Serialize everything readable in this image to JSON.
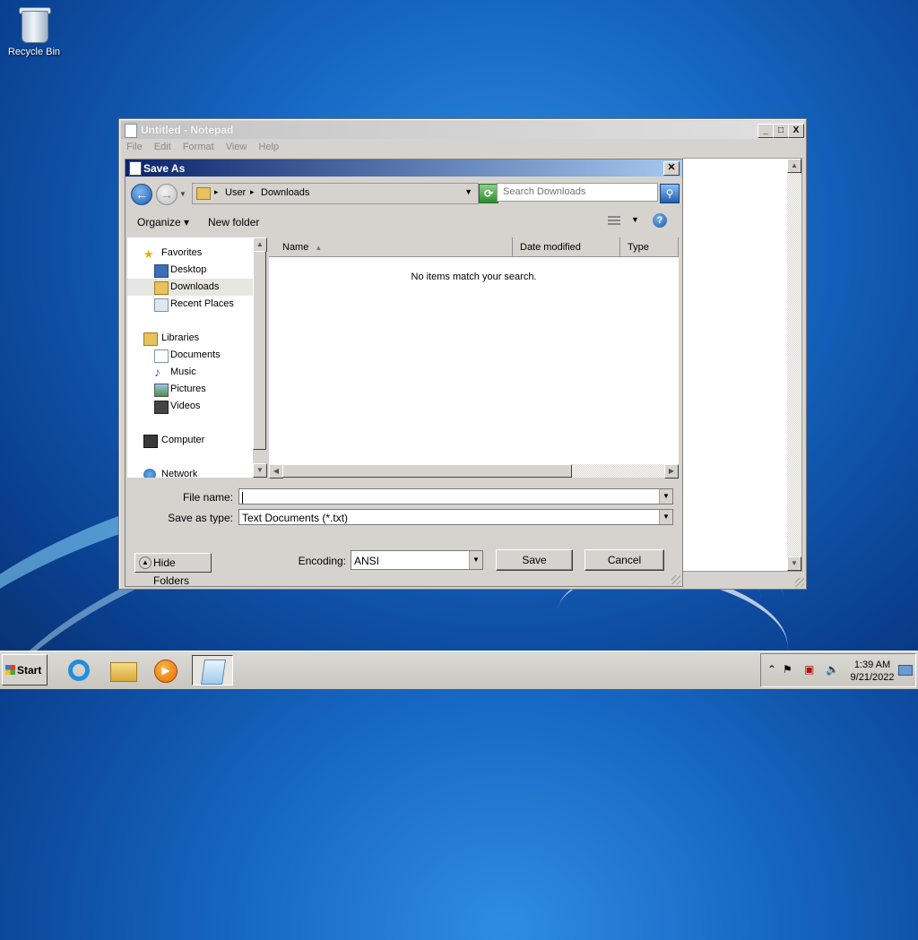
{
  "desktop": {
    "recycle_bin_label": "Recycle Bin"
  },
  "notepad": {
    "title": "Untitled - Notepad",
    "menu": [
      "File",
      "Edit",
      "Format",
      "View",
      "Help"
    ],
    "window_buttons": {
      "minimize": "_",
      "maximize": "□",
      "close": "X"
    }
  },
  "dialog": {
    "title": "Save As",
    "close_glyph": "✕",
    "address": {
      "crumb1": "User",
      "crumb2": "Downloads"
    },
    "search": {
      "placeholder": "Search Downloads"
    },
    "toolbar": {
      "organize": "Organize ▾",
      "new_folder": "New folder",
      "help": "?"
    },
    "nav": {
      "favorites": "Favorites",
      "desktop": "Desktop",
      "downloads": "Downloads",
      "recent_places": "Recent Places",
      "libraries": "Libraries",
      "documents": "Documents",
      "music": "Music",
      "pictures": "Pictures",
      "videos": "Videos",
      "computer": "Computer",
      "network": "Network"
    },
    "columns": {
      "name": "Name",
      "date_modified": "Date modified",
      "type": "Type"
    },
    "empty_message": "No items match your search.",
    "file_name_label": "File name:",
    "file_name_value": "",
    "save_as_type_label": "Save as type:",
    "save_as_type_value": "Text Documents (*.txt)",
    "encoding_label": "Encoding:",
    "encoding_value": "ANSI",
    "save_button": "Save",
    "cancel_button": "Cancel",
    "hide_folders": "Hide Folders"
  },
  "taskbar": {
    "start_label": "Start",
    "time": "1:39 AM",
    "date": "9/21/2022"
  },
  "colors": {
    "title_active_start": "#0a246a",
    "title_active_end": "#a6caf0",
    "face": "#d6d3ce"
  }
}
